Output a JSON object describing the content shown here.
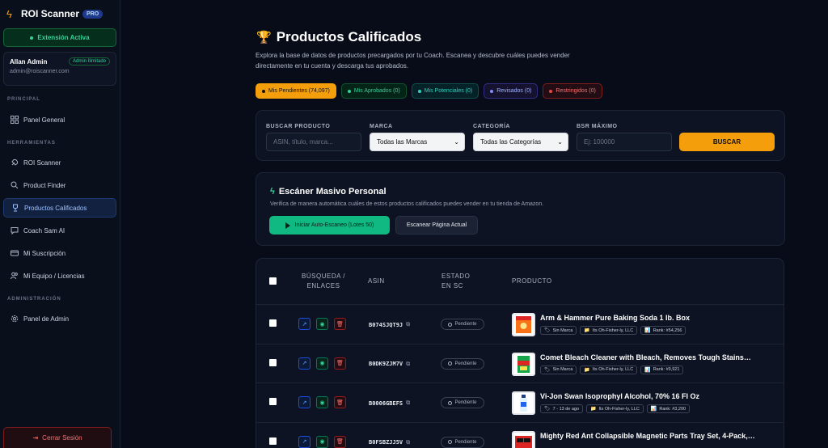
{
  "brand": {
    "name": "ROI Scanner",
    "badge": "PRO"
  },
  "extension_status": "Extensión Activa",
  "user": {
    "name": "Allan Admin",
    "role": "Admin Ilimitado",
    "email": "admin@roiscanner.com"
  },
  "sidebar": {
    "sections": {
      "principal": "PRINCIPAL",
      "tools": "HERRAMIENTAS",
      "admin": "ADMINISTRACIÓN"
    },
    "items": [
      {
        "label": "Panel General",
        "icon": "dashboard-icon"
      },
      {
        "label": "ROI Scanner",
        "icon": "rocket-icon"
      },
      {
        "label": "Product Finder",
        "icon": "search-icon"
      },
      {
        "label": "Productos Calificados",
        "icon": "trophy-icon",
        "active": true
      },
      {
        "label": "Coach Sam AI",
        "icon": "chat-icon"
      },
      {
        "label": "Mi Suscripción",
        "icon": "card-icon"
      },
      {
        "label": "Mi Equipo / Licencias",
        "icon": "users-icon"
      },
      {
        "label": "Panel de Admin",
        "icon": "gear-icon"
      }
    ],
    "logout": "Cerrar Sesión"
  },
  "page": {
    "title": "Productos Calificados",
    "description": "Explora la base de datos de productos precargados por tu Coach. Escanea y descubre cuáles puedes vender directamente en tu cuenta y descarga tus aprobados."
  },
  "filter_tabs": [
    {
      "label": "Mis Pendientes (74,097)",
      "active": true
    },
    {
      "label": "Mis Aprobados (0)"
    },
    {
      "label": "Mis Potenciales (0)"
    },
    {
      "label": "Revisados (0)"
    },
    {
      "label": "Restringidos (0)"
    }
  ],
  "filters": {
    "search_label": "BUSCAR PRODUCTO",
    "search_placeholder": "ASIN, título, marca...",
    "brand_label": "MARCA",
    "brand_value": "Todas las Marcas",
    "category_label": "CATEGORÍA",
    "category_value": "Todas las Categorías",
    "bsr_label": "BSR MÁXIMO",
    "bsr_placeholder": "Ej: 100000",
    "search_button": "BUSCAR"
  },
  "scanner": {
    "title": "Escáner Masivo Personal",
    "description": "Verifica de manera automática cuáles de estos productos calificados puedes vender en tu tienda de Amazon.",
    "auto_button": "Iniciar Auto-Escaneo (Lotes 50)",
    "page_button": "Escanear Página Actual"
  },
  "table": {
    "headers": {
      "links": "BÚSQUEDA / ENLACES",
      "asin": "ASIN",
      "status": "ESTADO EN SC",
      "product": "PRODUCTO"
    },
    "rows": [
      {
        "asin": "B074SJQT9J",
        "status": "Pendiente",
        "name": "Arm & Hammer Pure Baking Soda 1 lb. Box",
        "tags": [
          "Sin Marca",
          "Its Oh-Fisher-ly, LLC",
          "Rank: #54,256"
        ]
      },
      {
        "asin": "B0DK9ZJM7V",
        "status": "Pendiente",
        "name": "Comet Bleach Cleaner with Bleach, Removes Tough Stains…",
        "tags": [
          "Sin Marca",
          "Its Oh-Fisher-ly, LLC",
          "Rank: #9,921"
        ]
      },
      {
        "asin": "B0006GBEFS",
        "status": "Pendiente",
        "name": "Vi-Jon Swan Isoprophyl Alcohol, 70% 16 Fl Oz",
        "tags": [
          "7 - 13 de ago",
          "Its Oh-Fisher-ly, LLC",
          "Rank: #3,200"
        ]
      },
      {
        "asin": "B0FSBZJJ5V",
        "status": "Pendiente",
        "name": "Mighty Red Ant Collapsible Magnetic Parts Tray Set, 4-Pack,…",
        "tags": [
          "",
          "",
          ""
        ]
      }
    ]
  }
}
